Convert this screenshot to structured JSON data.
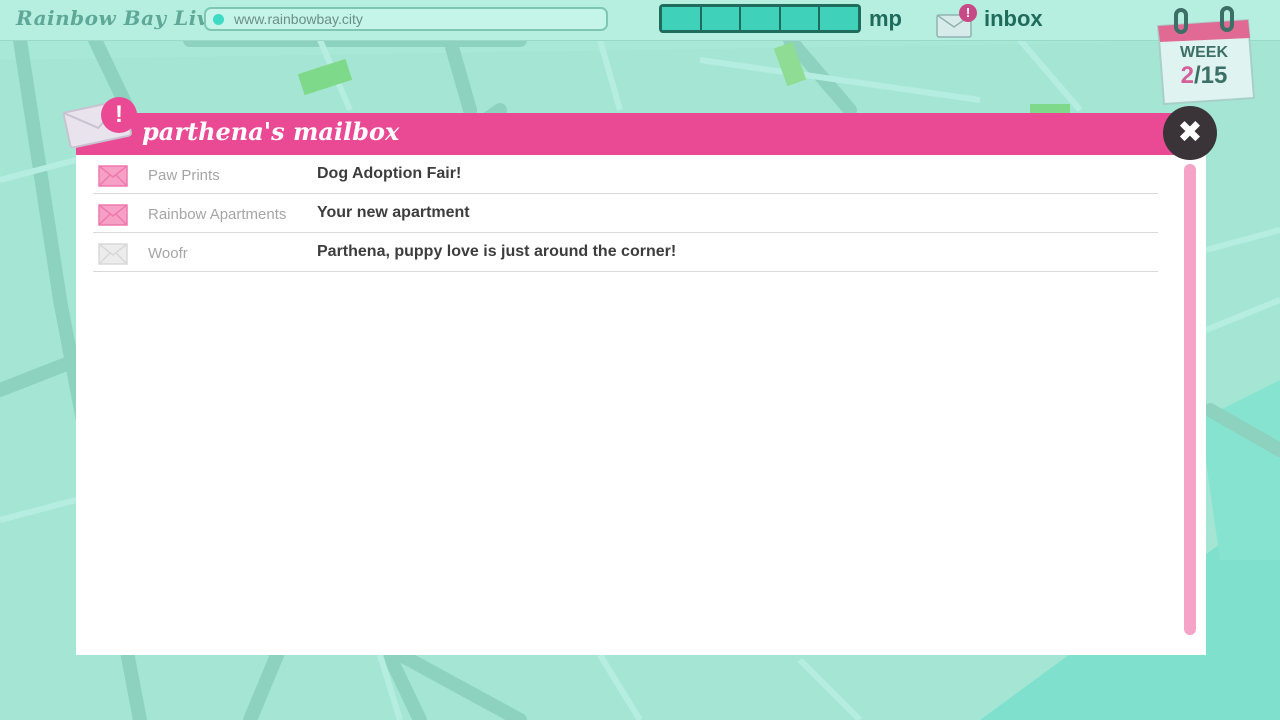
{
  "app": {
    "brand": "Rainbow Bay Live",
    "url": "www.rainbowbay.city"
  },
  "topbar": {
    "mp_label": "mp",
    "mp_segments": 5,
    "inbox_label": "inbox",
    "inbox_badge": "!"
  },
  "calendar": {
    "label": "WEEK",
    "current": "2",
    "separator": "/",
    "total": "15"
  },
  "mailbox": {
    "title": "parthena's mailbox",
    "alert_badge": "!",
    "close_label": "✖",
    "messages": [
      {
        "sender": "Paw Prints",
        "subject": "Dog Adoption Fair!",
        "unread": true
      },
      {
        "sender": "Rainbow Apartments",
        "subject": "Your new apartment",
        "unread": true
      },
      {
        "sender": "Woofr",
        "subject": "Parthena, puppy love is just around the corner!",
        "unread": false
      }
    ]
  },
  "colors": {
    "accent_pink": "#ea4a94",
    "teal_dark": "#1f6b5c",
    "teal_bright": "#3fd1b9",
    "map_base": "#9fe3d2"
  },
  "icons": {
    "unread_mail": "envelope-pink-icon",
    "read_mail": "envelope-grey-icon",
    "close": "close-icon",
    "calendar": "calendar-icon"
  }
}
